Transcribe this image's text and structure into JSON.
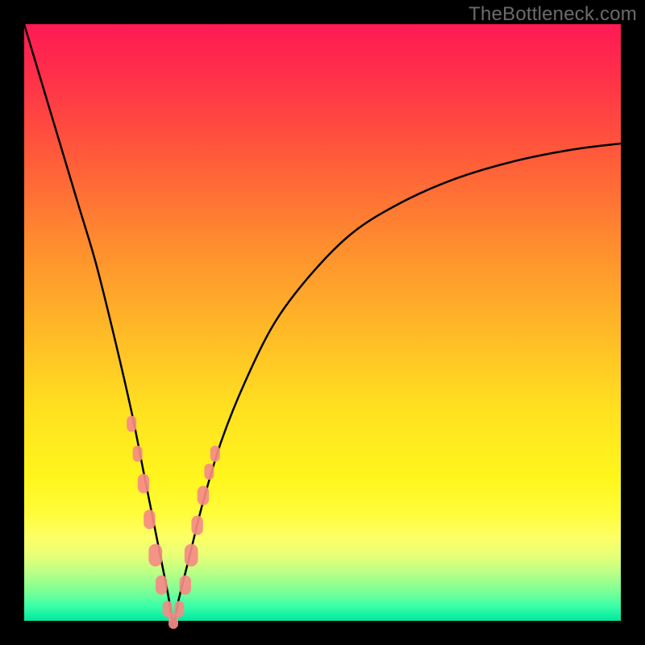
{
  "watermark": "TheBottleneck.com",
  "colors": {
    "frame": "#000000",
    "curve": "#000000",
    "marker_fill": "#f58b86",
    "marker_stroke": "#b02020"
  },
  "chart_data": {
    "type": "line",
    "title": "",
    "xlabel": "",
    "ylabel": "",
    "xlim": [
      0,
      100
    ],
    "ylim": [
      0,
      100
    ],
    "note": "V-shaped bottleneck curve. Minimum (0%) at x≈25. Left branch rises to 100% at x=0; right branch rises asymptotically toward ~80% at x=100.",
    "series": [
      {
        "name": "bottleneck-curve",
        "x": [
          0,
          3,
          6,
          9,
          12,
          15,
          18,
          20,
          22,
          24,
          25,
          26,
          28,
          30,
          33,
          37,
          42,
          48,
          55,
          63,
          72,
          82,
          92,
          100
        ],
        "values": [
          100,
          90,
          80,
          70,
          60,
          48,
          35,
          25,
          15,
          5,
          0,
          4,
          12,
          20,
          30,
          40,
          50,
          58,
          65,
          70,
          74,
          77,
          79,
          80
        ]
      }
    ],
    "markers": {
      "name": "highlighted-points",
      "x": [
        18,
        19,
        20,
        21,
        22,
        23,
        24,
        25,
        26,
        27,
        28,
        29,
        30,
        31,
        32
      ],
      "y": [
        33,
        28,
        23,
        17,
        11,
        6,
        2,
        0,
        2,
        6,
        11,
        16,
        21,
        25,
        28
      ],
      "r": [
        10,
        10,
        12,
        12,
        14,
        12,
        10,
        10,
        10,
        12,
        14,
        12,
        12,
        10,
        10
      ]
    }
  }
}
